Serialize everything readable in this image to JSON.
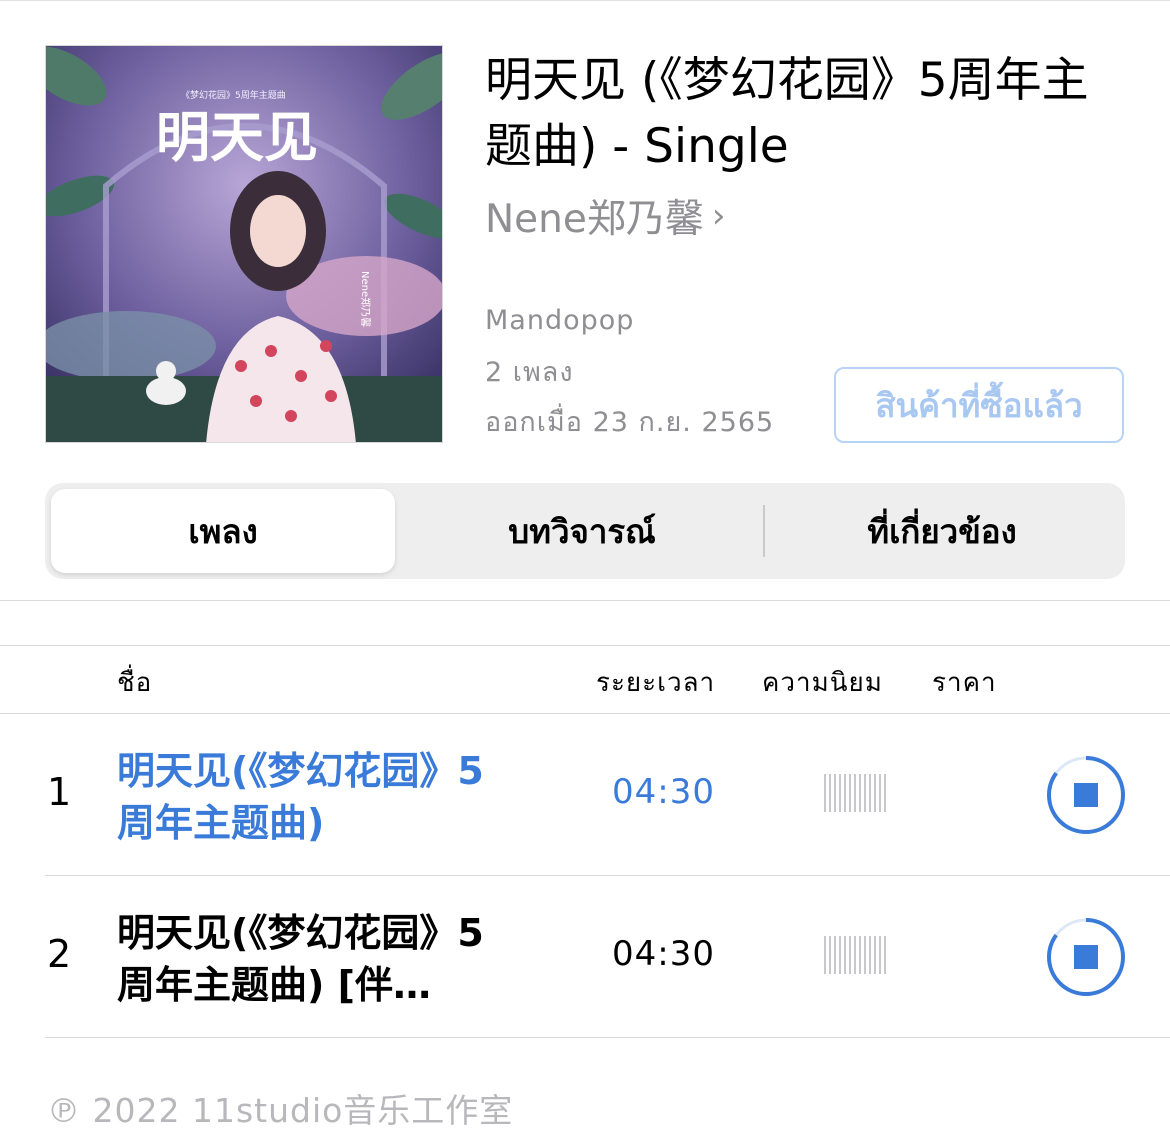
{
  "album": {
    "artwork_text": "明天见",
    "artwork_caption": "《梦幻花园》5周年主题曲",
    "artwork_artist": "Nene郑乃馨",
    "title": "明天见 (《梦幻花园》5周年主题曲) - Single",
    "artist": "Nene郑乃馨",
    "artist_chevron": "›",
    "genre": "Mandopop",
    "song_count": "2 เพลง",
    "release": "ออกเมื่อ 23 ก.ย. 2565",
    "purchased_label": "สินค้าที่ซื้อแล้ว"
  },
  "tabs": [
    {
      "label": "เพลง",
      "active": true
    },
    {
      "label": "บทวิจารณ์",
      "active": false
    },
    {
      "label": "ที่เกี่ยวข้อง",
      "active": false
    }
  ],
  "table": {
    "headers": {
      "name": "ชื่อ",
      "duration": "ระยะเวลา",
      "popularity": "ความนิยม",
      "price": "ราคา"
    },
    "rows": [
      {
        "number": "1",
        "title": "明天见(《梦幻花园》5周年主题曲)",
        "duration": "04:30",
        "playing": true,
        "progress": 0.85
      },
      {
        "number": "2",
        "title": "明天见(《梦幻花园》5周年主题曲) [伴…",
        "duration": "04:30",
        "playing": false,
        "progress": 0.85
      }
    ]
  },
  "footer": {
    "copyright": "℗ 2022 11studio音乐工作室"
  },
  "colors": {
    "accent": "#3a7bd9",
    "purchased_border": "#b7d3f5",
    "secondary_text": "#8e8e93"
  }
}
